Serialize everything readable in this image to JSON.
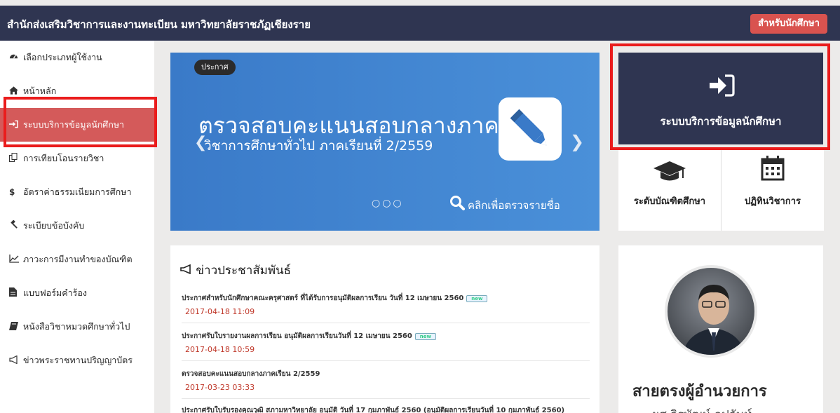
{
  "header": {
    "site_title": "สำนักส่งเสริมวิชาการและงานทะเบียน มหาวิทยาลัยราชภัฏเชียงราย",
    "student_button": "สำหรับนักศึกษา"
  },
  "sidebar": {
    "items": [
      {
        "label": "เลือกประเภทผู้ใช้งาน",
        "icon": "tachometer-icon"
      },
      {
        "label": "หน้าหลัก",
        "icon": "home-icon"
      },
      {
        "label": "ระบบบริการข้อมูลนักศึกษา",
        "icon": "sign-in-icon"
      },
      {
        "label": "การเทียบโอนรายวิชา",
        "icon": "copy-icon"
      },
      {
        "label": "อัตราค่าธรรมเนียมการศึกษา",
        "icon": "dollar-icon"
      },
      {
        "label": "ระเบียบข้อบังคับ",
        "icon": "gavel-icon"
      },
      {
        "label": "ภาวะการมีงานทำของบัณฑิต",
        "icon": "line-chart-icon"
      },
      {
        "label": "แบบฟอร์มคำร้อง",
        "icon": "file-icon"
      },
      {
        "label": "หนังสือวิชาหมวดศึกษาทั่วไป",
        "icon": "book-icon"
      },
      {
        "label": "ข่าวพระราชทานปริญญาบัตร",
        "icon": "bullhorn-icon"
      }
    ]
  },
  "banner": {
    "badge": "ประกาศ",
    "headline": "ตรวจสอบคะแนนสอบกลางภาค",
    "subline": "วิชาการศึกษาทั่วไป ภาคเรียนที่ 2/2559",
    "dots": "○○○",
    "click_text": "คลิกเพื่อตรวจรายชื่อ",
    "color": "#4286d1"
  },
  "service_tile": {
    "label": "ระบบบริการข้อมูลนักศึกษา",
    "icon": "sign-in-icon"
  },
  "quick_links": [
    {
      "label": "ระดับบัณฑิตศึกษา",
      "icon": "graduation-cap-icon"
    },
    {
      "label": "ปฏิทินวิชาการ",
      "icon": "calendar-icon"
    }
  ],
  "news": {
    "title": "ข่าวประชาสัมพันธ์",
    "new_tag": "new",
    "items": [
      {
        "headline": "ประกาศสำหรับนักศึกษาคณะครุศาสตร์ ที่ได้รับการอนุมัติผลการเรียน วันที่ 12 เมษายน 2560",
        "date": "2017-04-18 11:09",
        "is_new": true
      },
      {
        "headline": "ประกาศรับใบรายงานผลการเรียน อนุมัติผลการเรียนวันที่ 12 เมษายน 2560",
        "date": "2017-04-18 10:59",
        "is_new": true
      },
      {
        "headline": "ตรวจสอบคะแนนสอบกลางภาคเรียน 2/2559",
        "date": "2017-03-23 03:33",
        "is_new": false
      },
      {
        "headline": "ประกาศรับใบรับรองคุณวุฒิ สภามหาวิทยาลัย อนุมัติ วันที่ 17 กุมภาพันธ์ 2560 (อนุมัติผลการเรียนวันที่ 10 กุมภาพันธ์ 2560)",
        "date": "",
        "is_new": false
      }
    ]
  },
  "director": {
    "title": "สายตรงผู้อำนวยการ",
    "name": "ผศ.จิรพัฒน์ อุปจันท์"
  },
  "colors": {
    "navy": "#2f3551",
    "active_red": "#d45a5a",
    "highlight_border": "#ea1c1c",
    "date_red": "#c0392b"
  }
}
